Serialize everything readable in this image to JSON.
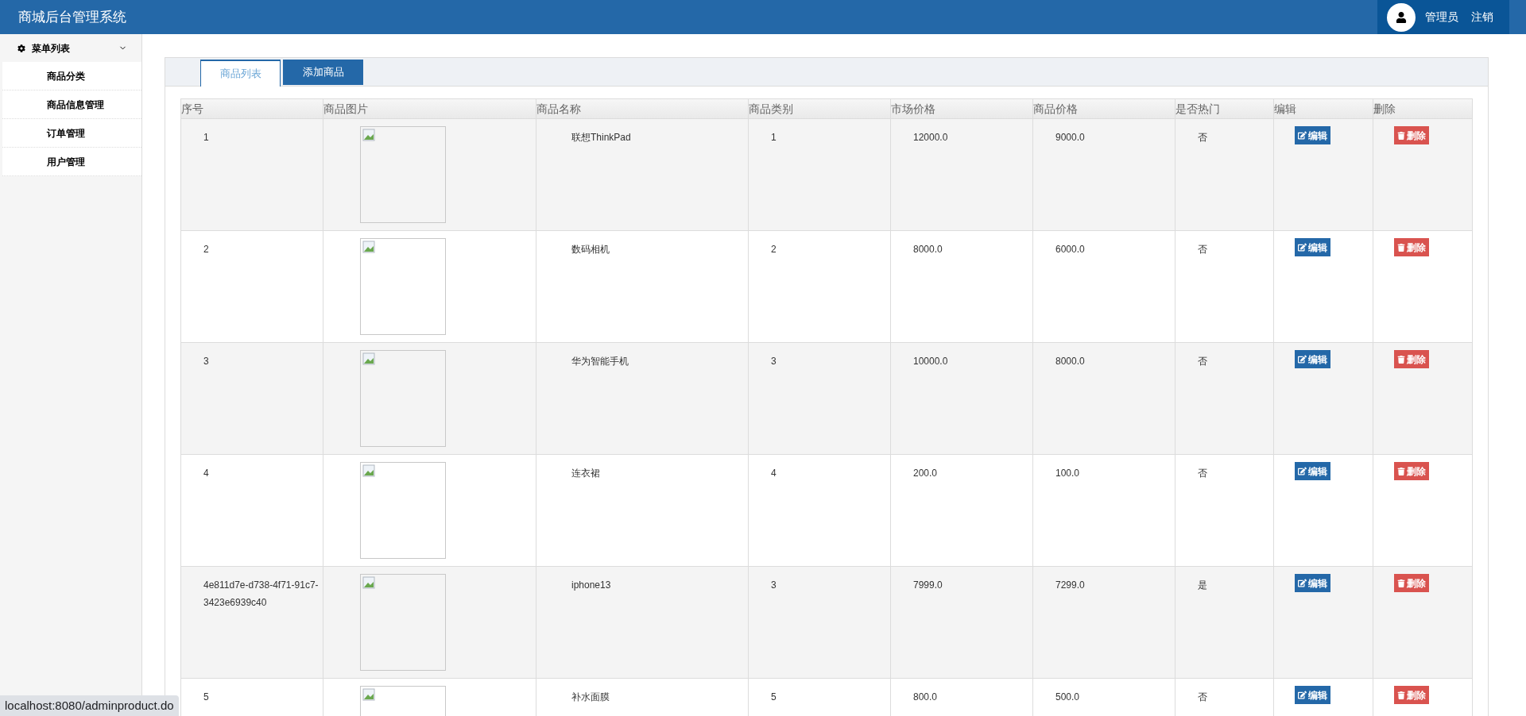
{
  "header": {
    "title": "商城后台管理系统",
    "user": "管理员",
    "logout": "注销"
  },
  "sidebar": {
    "title": "菜单列表",
    "expanded": true,
    "items": [
      {
        "label": "商品分类"
      },
      {
        "label": "商品信息管理"
      },
      {
        "label": "订单管理"
      },
      {
        "label": "用户管理"
      }
    ]
  },
  "tabs": [
    {
      "label": "商品列表",
      "selected": true
    },
    {
      "label": "添加商品",
      "selected": false
    }
  ],
  "table": {
    "columns": [
      "序号",
      "商品图片",
      "商品名称",
      "商品类别",
      "市场价格",
      "商品价格",
      "是否热门",
      "编辑",
      "删除"
    ],
    "rows": [
      {
        "id": "1",
        "name": "联想ThinkPad",
        "category": "1",
        "market_price": "12000.0",
        "price": "9000.0",
        "hot": "否",
        "edit": "编辑",
        "delete": "删除"
      },
      {
        "id": "2",
        "name": "数码相机",
        "category": "2",
        "market_price": "8000.0",
        "price": "6000.0",
        "hot": "否",
        "edit": "编辑",
        "delete": "删除"
      },
      {
        "id": "3",
        "name": "华为智能手机",
        "category": "3",
        "market_price": "10000.0",
        "price": "8000.0",
        "hot": "否",
        "edit": "编辑",
        "delete": "删除"
      },
      {
        "id": "4",
        "name": "连衣裙",
        "category": "4",
        "market_price": "200.0",
        "price": "100.0",
        "hot": "否",
        "edit": "编辑",
        "delete": "删除"
      },
      {
        "id": "4e811d7e-d738-4f71-91c7-3423e6939c40",
        "name": "iphone13",
        "category": "3",
        "market_price": "7999.0",
        "price": "7299.0",
        "hot": "是",
        "edit": "编辑",
        "delete": "删除"
      },
      {
        "id": "5",
        "name": "补水面膜",
        "category": "5",
        "market_price": "800.0",
        "price": "500.0",
        "hot": "否",
        "edit": "编辑",
        "delete": "删除"
      }
    ]
  },
  "status_bar": {
    "url": "localhost:8080/adminproduct.do"
  }
}
